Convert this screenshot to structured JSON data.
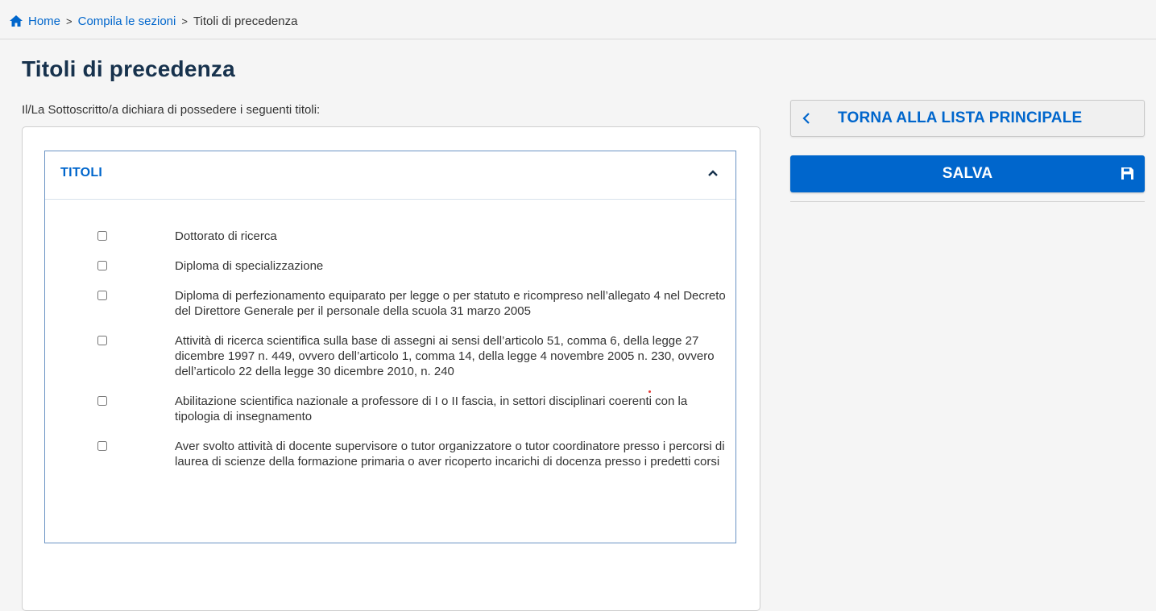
{
  "breadcrumb": {
    "home": "Home",
    "sections": "Compila le sezioni",
    "current": "Titoli di precedenza",
    "separator": ">"
  },
  "page": {
    "title": "Titoli di precedenza",
    "intro": "Il/La Sottoscritto/a dichiara di possedere i seguenti titoli:"
  },
  "accordion": {
    "title": "TITOLI",
    "expanded": true,
    "items": [
      {
        "label": "Dottorato di ricerca",
        "checked": false
      },
      {
        "label": "Diploma di specializzazione",
        "checked": false
      },
      {
        "label": "Diploma di perfezionamento equiparato per legge o per statuto e ricompreso nell’allegato 4 nel Decreto del Direttore Generale per il personale della scuola 31 marzo 2005",
        "checked": false
      },
      {
        "label": "Attività di ricerca scientifica sulla base di assegni ai sensi dell’articolo 51, comma 6, della legge 27 dicembre 1997 n. 449, ovvero dell’articolo 1, comma 14, della legge 4 novembre 2005 n. 230, ovvero dell’articolo 22 della legge 30 dicembre 2010, n. 240",
        "checked": false
      },
      {
        "label": "Abilitazione scientifica nazionale a professore di I o II fascia, in settori disciplinari coerenti con la tipologia di insegnamento",
        "checked": false
      },
      {
        "label": "Aver svolto attività di docente supervisore o tutor organizzatore o tutor coordinatore presso i percorsi di laurea di scienze della formazione primaria o aver ricoperto incarichi di docenza presso i predetti corsi",
        "checked": false
      }
    ]
  },
  "actions": {
    "back_label": "TORNA ALLA LISTA PRINCIPALE",
    "save_label": "SALVA",
    "back_icon": "chevron-left-icon",
    "save_icon": "floppy-disk-icon"
  },
  "colors": {
    "primary": "#0066cc",
    "title": "#17324d",
    "accordion_border": "#6a93c4"
  }
}
